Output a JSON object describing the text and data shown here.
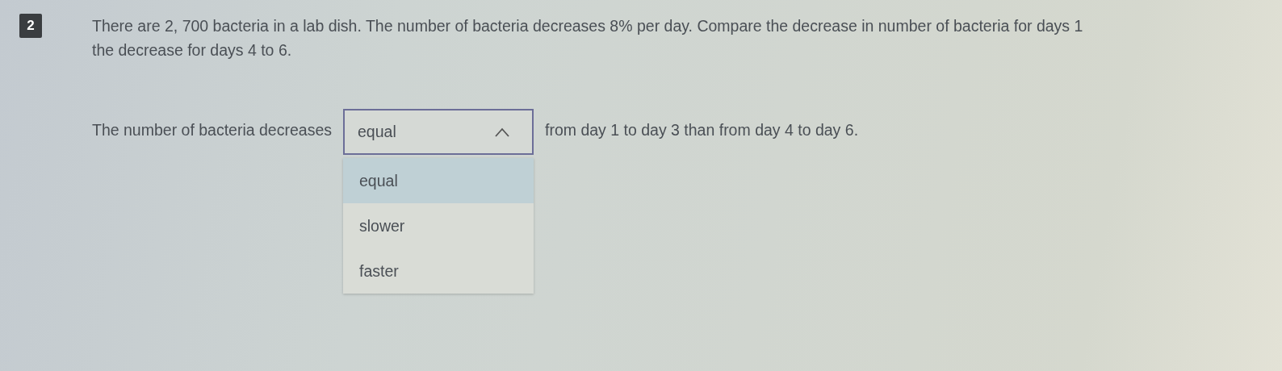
{
  "question": {
    "number": "2",
    "lines": [
      "There are 2, 700 bacteria in a lab dish. The number of bacteria decreases 8% per day. Compare the decrease in number of bacteria for days 1",
      "the decrease for days 4 to 6."
    ]
  },
  "answer": {
    "before": "The number of bacteria decreases",
    "select": {
      "value": "equal",
      "expanded": true
    },
    "after": "from day 1 to day 3 than from day 4 to day 6.",
    "options": [
      {
        "label": "equal",
        "selected": true
      },
      {
        "label": "slower",
        "selected": false
      },
      {
        "label": "faster",
        "selected": false
      }
    ]
  }
}
